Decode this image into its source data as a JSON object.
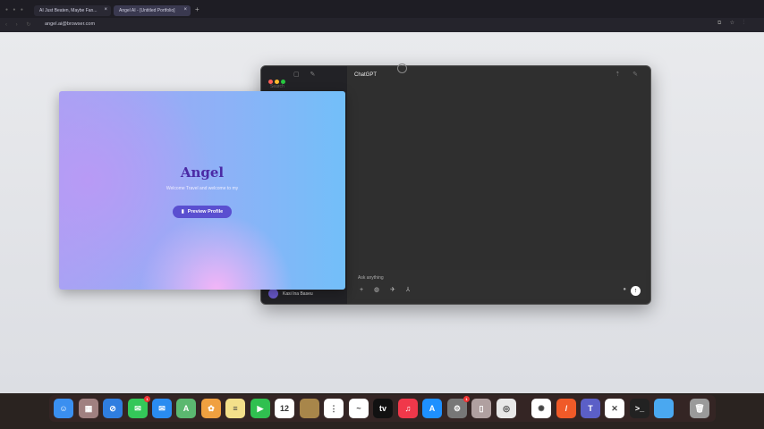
{
  "browser": {
    "tabs": [
      {
        "label": "AI Just Beaten, Maybe Fan..."
      },
      {
        "label": "Angel AI - [Untitled Portfolio]"
      }
    ],
    "url": "angel.ai@browser.com"
  },
  "card": {
    "title": "Angel",
    "subtitle": "Welcome Travel and welcome to my",
    "button": "Preview Profile"
  },
  "chatgpt": {
    "title": "ChatGPT",
    "search": "Search",
    "user": "Kasi Ina Baseu",
    "placeholder": "Ask anything"
  },
  "dock": {
    "items": [
      {
        "name": "finder",
        "color": "#3a8ff0",
        "glyph": "☺"
      },
      {
        "name": "launchpad",
        "color": "#a08080",
        "glyph": "▦"
      },
      {
        "name": "safari",
        "color": "#2f7ee0",
        "glyph": "⊘"
      },
      {
        "name": "messages",
        "color": "#34c759",
        "glyph": "✉",
        "badge": "1"
      },
      {
        "name": "mail",
        "color": "#2a8cf0",
        "glyph": "✉"
      },
      {
        "name": "maps",
        "color": "#5bb870",
        "glyph": "A"
      },
      {
        "name": "photos",
        "color": "#f0a040",
        "glyph": "✿"
      },
      {
        "name": "notes",
        "color": "#f4e08a",
        "glyph": "≡"
      },
      {
        "name": "facetime",
        "color": "#30c050",
        "glyph": "▶"
      },
      {
        "name": "calendar",
        "color": "#ffffff",
        "glyph": "12"
      },
      {
        "name": "app",
        "color": "#a8864a",
        "glyph": ""
      },
      {
        "name": "reminders",
        "color": "#ffffff",
        "glyph": "⋮"
      },
      {
        "name": "freeform",
        "color": "#ffffff",
        "glyph": "~"
      },
      {
        "name": "apple-tv",
        "color": "#111111",
        "glyph": "tv"
      },
      {
        "name": "music",
        "color": "#f0384a",
        "glyph": "♫"
      },
      {
        "name": "app-store",
        "color": "#1e90ff",
        "glyph": "A"
      },
      {
        "name": "system-settings",
        "color": "#777777",
        "glyph": "⚙",
        "badge": "1"
      },
      {
        "name": "preview",
        "color": "#b0a0a0",
        "glyph": "▯"
      },
      {
        "name": "chrome",
        "color": "#e8e8e8",
        "glyph": "◎"
      },
      {
        "name": "chatgpt",
        "color": "#ffffff",
        "glyph": "✺"
      },
      {
        "name": "pen-app",
        "color": "#f05a28",
        "glyph": "/"
      },
      {
        "name": "teams",
        "color": "#5b5fc7",
        "glyph": "T"
      },
      {
        "name": "capcut",
        "color": "#ffffff",
        "glyph": "✕"
      },
      {
        "name": "terminal",
        "color": "#222222",
        "glyph": ">_"
      },
      {
        "name": "folder",
        "color": "#4aa8f0",
        "glyph": ""
      },
      {
        "name": "trash",
        "color": "#9a9a9a",
        "glyph": "🗑"
      }
    ]
  }
}
